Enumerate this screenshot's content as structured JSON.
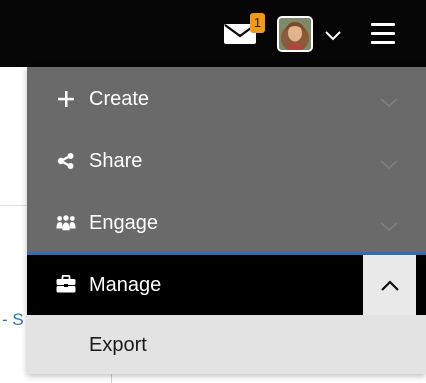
{
  "header": {
    "notifications": {
      "icon": "envelope-icon",
      "badge_count": "1",
      "badge_color": "#f29a17"
    },
    "user_menu": {
      "avatar": "user-avatar",
      "chevron_icon": "chevron-down-icon"
    },
    "main_menu_icon": "hamburger-icon",
    "background_color": "#050505"
  },
  "background_page": {
    "partial_link_text": "- S"
  },
  "menu": {
    "items": [
      {
        "label": "Create",
        "icon": "plus-icon",
        "expanded": false
      },
      {
        "label": "Share",
        "icon": "share-icon",
        "expanded": false
      },
      {
        "label": "Engage",
        "icon": "people-group-icon",
        "expanded": false
      },
      {
        "label": "Manage",
        "icon": "briefcase-icon",
        "expanded": true
      }
    ],
    "manage_submenu": [
      {
        "label": "Export"
      }
    ],
    "colors": {
      "collapsed_row": "#6a6a6a",
      "active_row": "#000000",
      "divider": "#2d6fb3",
      "submenu": "#e3e3e3"
    }
  }
}
